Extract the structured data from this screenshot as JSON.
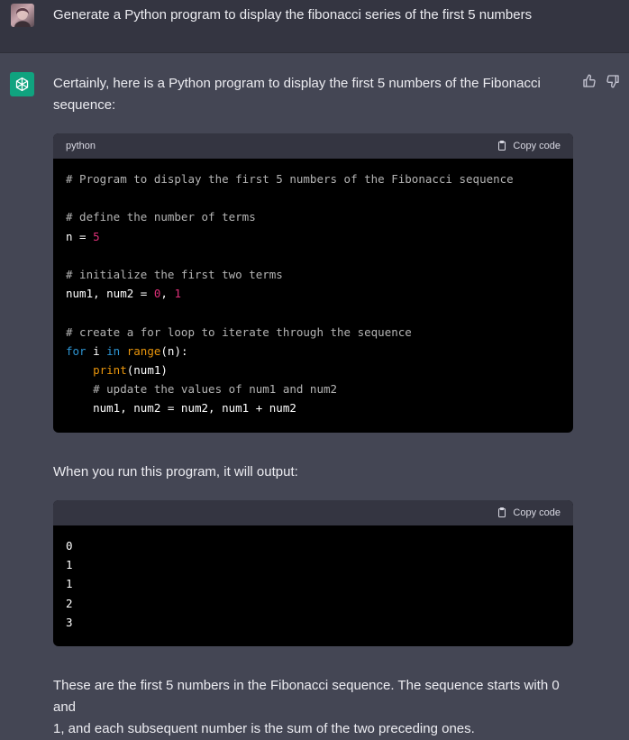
{
  "user": {
    "message": "Generate a Python program to display the fibonacci series of the first 5 numbers"
  },
  "assistant": {
    "intro_line1": "Certainly, here is a Python program to display the first 5 numbers of the Fibonacci",
    "intro_line2": "sequence:",
    "code_block_1": {
      "language": "python",
      "copy_label": "Copy code",
      "lines": [
        "# Program to display the first 5 numbers of the Fibonacci sequence",
        "",
        "# define the number of terms",
        "n = 5",
        "",
        "# initialize the first two terms",
        "num1, num2 = 0, 1",
        "",
        "# create a for loop to iterate through the sequence",
        "for i in range(n):",
        "    print(num1)",
        "    # update the values of num1 and num2",
        "    num1, num2 = num2, num1 + num2"
      ]
    },
    "middle_text": "When you run this program, it will output:",
    "code_block_2": {
      "copy_label": "Copy code",
      "lines": [
        "0",
        "1",
        "1",
        "2",
        "3"
      ]
    },
    "outro_line1": "These are the first 5 numbers in the Fibonacci sequence. The sequence starts with 0 and",
    "outro_line2": "1, and each subsequent number is the sum of the two preceding ones."
  },
  "icons": {
    "user_avatar": "user-avatar-photo",
    "assistant_avatar": "openai-logo-icon",
    "thumbs_up": "thumbs-up-icon",
    "thumbs_down": "thumbs-down-icon",
    "copy": "clipboard-icon"
  },
  "colors": {
    "page_bg": "#444654",
    "user_row_bg": "#343541",
    "brand_green": "#10a37f",
    "code_bg": "#000000",
    "comment": "#b4b4b4",
    "number": "#df3079",
    "keyword": "#2e95d3",
    "builtin": "#e9950c"
  }
}
